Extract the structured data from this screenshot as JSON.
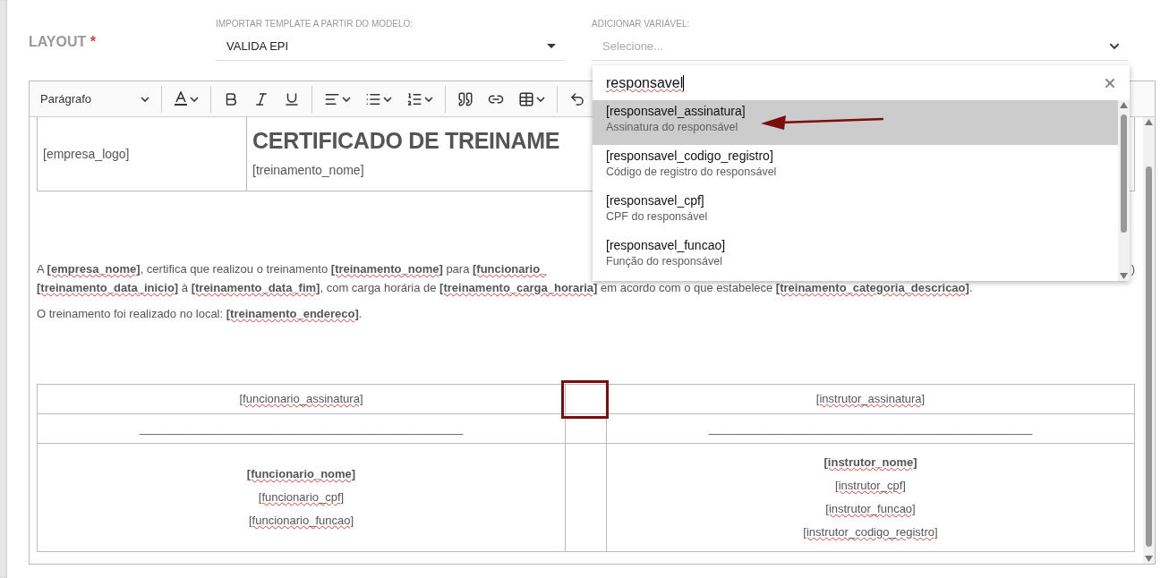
{
  "layout_label": {
    "text": "LAYOUT",
    "required_mark": "*"
  },
  "template_select": {
    "label": "IMPORTAR TEMPLATE A PARTIR DO MODELO:",
    "value": "VALIDA EPI"
  },
  "variable_select": {
    "label": "ADICIONAR VARIÁVEL:",
    "placeholder": "Selecione...",
    "expanded": true,
    "search": {
      "value": "responsavel"
    },
    "options": [
      {
        "name": "[responsavel_assinatura]",
        "description": "Assinatura do responsável",
        "selected": true
      },
      {
        "name": "[responsavel_codigo_registro]",
        "description": "Código de registro do responsável",
        "selected": false
      },
      {
        "name": "[responsavel_cpf]",
        "description": "CPF do responsável",
        "selected": false
      },
      {
        "name": "[responsavel_funcao]",
        "description": "Função do responsável",
        "selected": false
      }
    ]
  },
  "toolbar": {
    "block_style": "Parágrafo"
  },
  "document": {
    "header": {
      "logo": "[empresa_logo]",
      "title": "CERTIFICADO DE TREINAME",
      "subtitle": "[treinamento_nome]"
    },
    "paragraph_lines": [
      {
        "left": "A **[empresa_nome]**, certifica que realizou o treinamento **[treinamento_nome]** para **[funcionario_**",
        "right": ")"
      },
      {
        "left": "**[treinamento_data_inicio]** à **[treinamento_data_fim]**, com carga horária de **[treinamento_carga_horaria]** em acordo com o que estabelece **[treinamento_categoria_descricao]**."
      },
      {
        "left": "O treinamento foi realizado no local: **[treinamento_endereco]**."
      }
    ],
    "signature_table": {
      "rows": [
        {
          "left": [
            {
              "text": "[funcionario_assinatura]",
              "bold": false
            }
          ],
          "right": [
            {
              "text": "[instrutor_assinatura]",
              "bold": false
            }
          ]
        },
        {
          "left": [
            {
              "text": "__________________________________________________",
              "bold": false,
              "kind": "rule"
            }
          ],
          "right": [
            {
              "text": "__________________________________________________",
              "bold": false,
              "kind": "rule"
            }
          ]
        },
        {
          "left": [
            {
              "text": "[funcionario_nome]",
              "bold": true
            },
            {
              "text": "[funcionario_cpf]",
              "bold": false
            },
            {
              "text": "[funcionario_funcao]",
              "bold": false
            }
          ],
          "right": [
            {
              "text": "[instrutor_nome]",
              "bold": true
            },
            {
              "text": "[instrutor_cpf]",
              "bold": false
            },
            {
              "text": "[instrutor_funcao]",
              "bold": false
            },
            {
              "text": "[instrutor_codigo_registro]",
              "bold": false
            }
          ]
        }
      ]
    }
  }
}
